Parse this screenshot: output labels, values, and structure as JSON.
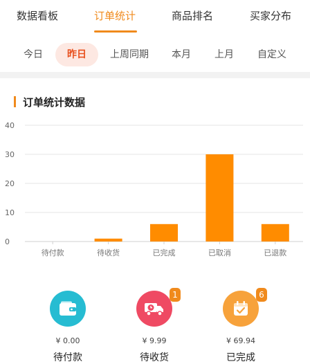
{
  "top_tabs": {
    "items": [
      {
        "label": "数据看板"
      },
      {
        "label": "订单统计"
      },
      {
        "label": "商品排名"
      },
      {
        "label": "买家分布"
      }
    ],
    "active": "订单统计",
    "accent_color": "#f08a1c"
  },
  "date_filters": {
    "items": [
      {
        "label": "今日"
      },
      {
        "label": "昨日"
      },
      {
        "label": "上周同期"
      },
      {
        "label": "本月"
      },
      {
        "label": "上月"
      },
      {
        "label": "自定义"
      }
    ],
    "active": "昨日"
  },
  "section": {
    "title": "订单统计数据"
  },
  "chart_data": {
    "type": "bar",
    "categories": [
      "待付款",
      "待收货",
      "已完成",
      "已取消",
      "已退款"
    ],
    "values": [
      0,
      1,
      6,
      30,
      6
    ],
    "ylim": [
      0,
      40
    ],
    "yticks": [
      0,
      10,
      20,
      30,
      40
    ],
    "grid": true,
    "bar_color": "#ff8c00"
  },
  "stats": [
    {
      "amount": "¥ 0.00",
      "label": "待付款",
      "icon": "wallet-icon",
      "color": "#26bcd2",
      "badge": ""
    },
    {
      "amount": "¥ 9.99",
      "label": "待收货",
      "icon": "delivery-truck-icon",
      "color": "#ef4a63",
      "badge": "1"
    },
    {
      "amount": "¥ 69.94",
      "label": "已完成",
      "icon": "calendar-check-icon",
      "color": "#f7a23b",
      "badge": "6"
    }
  ]
}
